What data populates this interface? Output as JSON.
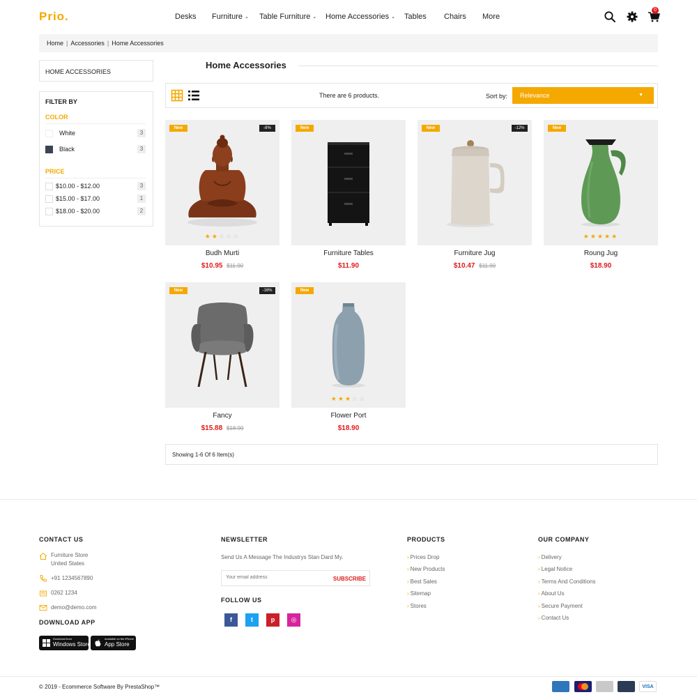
{
  "brand": {
    "logo": "Prio."
  },
  "nav": {
    "items": [
      {
        "label": "Desks",
        "has_dropdown": false
      },
      {
        "label": "Furniture",
        "has_dropdown": true
      },
      {
        "label": "Table Furniture",
        "has_dropdown": true
      },
      {
        "label": "Home Accessories",
        "has_dropdown": true
      },
      {
        "label": "Tables",
        "has_dropdown": false
      },
      {
        "label": "Chairs",
        "has_dropdown": false
      },
      {
        "label": "More",
        "has_dropdown": false
      }
    ],
    "cart_count": "0",
    "icons": [
      "search-icon",
      "gear-icon",
      "cart-icon"
    ]
  },
  "breadcrumb": [
    "Home",
    "Accessories",
    "Home Accessories"
  ],
  "sidebar": {
    "category_title": "HOME ACCESSORIES",
    "filter_title": "FILTER BY",
    "color_label": "COLOR",
    "colors": [
      {
        "label": "White",
        "count": "3",
        "swatch": "#ffffff"
      },
      {
        "label": "Black",
        "count": "3",
        "swatch": "#3a4453"
      }
    ],
    "price_label": "PRICE",
    "prices": [
      {
        "label": "$10.00 - $12.00",
        "count": "3"
      },
      {
        "label": "$15.00 - $17.00",
        "count": "1"
      },
      {
        "label": "$18.00 - $20.00",
        "count": "2"
      }
    ]
  },
  "main": {
    "title": "Home Accessories",
    "product_count_text": "There are 6 products.",
    "sort_label": "Sort by:",
    "sort_value": "Relevance",
    "showing_text": "Showing 1-6 Of 6 Item(s)"
  },
  "products": [
    {
      "name": "Budh Murti",
      "price": "$10.95",
      "old_price": "$11.90",
      "badge": "New",
      "discount": "-8%",
      "rating": 2,
      "image": "buddha-statue"
    },
    {
      "name": "Furniture Tables",
      "price": "$11.90",
      "old_price": "",
      "badge": "New",
      "discount": "",
      "rating": 0,
      "image": "black-cabinet"
    },
    {
      "name": "Furniture Jug",
      "price": "$10.47",
      "old_price": "$11.90",
      "badge": "New",
      "discount": "-12%",
      "rating": 0,
      "image": "white-jug"
    },
    {
      "name": "Roung Jug",
      "price": "$18.90",
      "old_price": "",
      "badge": "New",
      "discount": "",
      "rating": 5,
      "image": "green-jug"
    },
    {
      "name": "Fancy",
      "price": "$15.88",
      "old_price": "$18.90",
      "badge": "New",
      "discount": "-16%",
      "rating": 0,
      "image": "grey-armchair"
    },
    {
      "name": "Flower Port",
      "price": "$18.90",
      "old_price": "",
      "badge": "New",
      "discount": "",
      "rating": 3,
      "image": "blue-vase"
    }
  ],
  "footer": {
    "contact": {
      "title": "CONTACT US",
      "address_line1": "Furniture Store",
      "address_line2": "United States",
      "phone": "+91 1234567890",
      "fax": "0262 1234",
      "email": "demo@demo.com"
    },
    "download": {
      "title": "DOWNLOAD APP",
      "windows_small": "Download from",
      "windows_big": "Windows Store",
      "apple_small": "Available on the iPhone",
      "apple_big": "App Store"
    },
    "newsletter": {
      "title": "NEWSLETTER",
      "text": "Send Us A Message The Industrys Stan Dard My.",
      "placeholder": "Your email address",
      "button": "SUBSCRIBE"
    },
    "follow": {
      "title": "FOLLOW US",
      "networks": [
        {
          "name": "facebook",
          "glyph": "f",
          "color": "#3b5998"
        },
        {
          "name": "twitter",
          "glyph": "t",
          "color": "#1da1f2"
        },
        {
          "name": "pinterest",
          "glyph": "p",
          "color": "#cb2027"
        },
        {
          "name": "instagram",
          "glyph": "◎",
          "color": "#d6249f"
        }
      ]
    },
    "products": {
      "title": "PRODUCTS",
      "links": [
        "Prices Drop",
        "New Products",
        "Best Sales",
        "Sitemap",
        "Stores"
      ]
    },
    "company": {
      "title": "OUR COMPANY",
      "links": [
        "Delivery",
        "Legal Notice",
        "Terms And Conditions",
        "About Us",
        "Secure Payment",
        "Contact Us"
      ]
    },
    "copyright": "© 2019 - Ecommerce Software By PrestaShop™",
    "payments": [
      {
        "name": "amex",
        "color": "#2e77bb"
      },
      {
        "name": "mastercard",
        "color": "#1a1f71"
      },
      {
        "name": "paypal",
        "color": "#c9c9c9"
      },
      {
        "name": "discover",
        "color": "#2b3a55"
      },
      {
        "name": "VISA",
        "color": "#1a6fb5"
      }
    ]
  },
  "colors": {
    "accent": "#f5a800",
    "price": "#e21a1a",
    "dark": "#222222"
  }
}
